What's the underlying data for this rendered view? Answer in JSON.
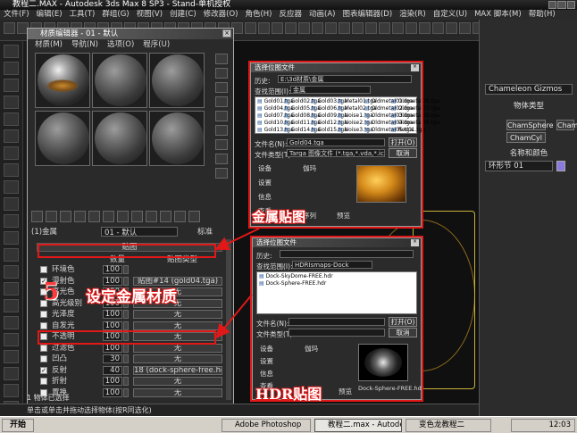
{
  "app": {
    "title": "教程二.MAX - Autodesk 3ds Max 8 SP3 - Stand-单机授权",
    "menu": [
      "文件(F)",
      "编辑(E)",
      "工具(T)",
      "群组(G)",
      "视图(V)",
      "创建(C)",
      "修改器(O)",
      "角色(H)",
      "反应器",
      "动画(A)",
      "图表编辑器(D)",
      "渲染(R)",
      "自定义(U)",
      "MAX 脚本(M)",
      "帮助(H)"
    ],
    "view_dropdown": "视图"
  },
  "command_panel": {
    "gizmo_dropdown": "Chameleon Gizmos",
    "object_type_header": "物体类型",
    "buttons": [
      "ChamSphere",
      "ChamBox",
      "ChamCyl"
    ],
    "name_color_header": "名称和颜色",
    "name_value": "环形节 01"
  },
  "material_editor": {
    "title": "材质编辑器 - 01 - 默认",
    "menu": [
      "材质(M)",
      "导航(N)",
      "选项(O)",
      "程序(U)"
    ],
    "material_name": "01 - 默认",
    "type_label": "标准",
    "shader_prefix": "(1)金属",
    "maps_header": "贴图",
    "col_amount": "数量",
    "col_map": "贴图类型",
    "maps": [
      {
        "checked": false,
        "label": "环境色",
        "amount": "100",
        "map": ""
      },
      {
        "checked": true,
        "label": "漫射色",
        "amount": "100",
        "map": "贴图#14 (gold04.tga)"
      },
      {
        "checked": false,
        "label": "高光色",
        "amount": "100",
        "map": "无"
      },
      {
        "checked": false,
        "label": "高光级别",
        "amount": "100",
        "map": "无"
      },
      {
        "checked": false,
        "label": "光泽度",
        "amount": "100",
        "map": "无"
      },
      {
        "checked": false,
        "label": "自发光",
        "amount": "100",
        "map": "无"
      },
      {
        "checked": false,
        "label": "不透明",
        "amount": "100",
        "map": "无"
      },
      {
        "checked": false,
        "label": "过滤色",
        "amount": "100",
        "map": "无"
      },
      {
        "checked": false,
        "label": "凹凸",
        "amount": "30",
        "map": "无"
      },
      {
        "checked": true,
        "label": "反射",
        "amount": "40",
        "map": "18 (dock-sphere-free.hdr"
      },
      {
        "checked": false,
        "label": "折射",
        "amount": "100",
        "map": "无"
      },
      {
        "checked": false,
        "label": "置换",
        "amount": "100",
        "map": "无"
      }
    ]
  },
  "dialog_top": {
    "title": "选择位图文件",
    "history_label": "历史:",
    "history_value": "E:\\3d材质\\金属",
    "lookin_label": "查找范围(I):",
    "lookin_value": "金属",
    "files": [
      "Gold01.tga",
      "Gold04.tga",
      "Gold07.tga",
      "Gold10.tga",
      "Gold13.tga",
      "Gold02.tga",
      "Gold05.tga",
      "Gold08.tga",
      "Gold11.tga",
      "Gold14.tga",
      "Gold03.tga",
      "Gold06.tga",
      "Gold09.tga",
      "Gold12.tga",
      "Gold15.tga",
      "Metal01.tga",
      "Metal02.tga",
      "Noise1.tga",
      "Noise2.tga",
      "Noise3.tga",
      "Oldmetal01.tga",
      "Oldmetal02.tga",
      "Oldmetal03.tga",
      "Oldmetal04.tga",
      "Oldmetal05.tga",
      "Oldmetal06.tga",
      "Oldmetal07.tga",
      "Oldmetal08.tga",
      "Oldmetal09.tga",
      "Red01.tga"
    ],
    "filename_label": "文件名(N):",
    "filename_value": "Gold04.tga",
    "filetype_label": "文件类型(T):",
    "filetype_value": "Targa 图像文件 (*.tga,*.vda,*.icb,*.vst)",
    "open_label": "打开(O)",
    "cancel_label": "取消",
    "device_label": "设备",
    "setup_label": "设置",
    "info_label": "信息",
    "view_label": "查看",
    "gamma_label": "伽玛",
    "sequence_label": "序列",
    "preview_label": "预览"
  },
  "dialog_bottom": {
    "title": "选择位图文件",
    "history_label": "历史:",
    "lookin_label": "查找范围(I):",
    "lookin_value": "HDRIsmaps-Dock",
    "files": [
      "Dock-SkyDome-FREE.hdr",
      "Dock-Sphere-FREE.hdr"
    ],
    "filename_label": "文件名(N):",
    "filename_value": "Dock-Sphere-FREE.hdr",
    "filetype_label": "文件类型(T):",
    "open_label": "打开(O)",
    "cancel_label": "取消",
    "device_label": "设备",
    "setup_label": "设置",
    "info_label": "信息",
    "view_label": "查看",
    "gamma_label": "伽玛",
    "sequence_label": "序列",
    "preview_label": "预览"
  },
  "annotations": {
    "step_number": "5",
    "step_text": "设定金属材质",
    "metal_map": "金属贴图",
    "hdr_map": "HDR贴图"
  },
  "status": {
    "text": "单击或单击并拖动选择物体(按R同选化)",
    "selected": "1 物体已选择"
  },
  "taskbar": {
    "start": "开始",
    "items": [
      "Adobe Photoshop",
      "教程二.max - Autodesk ...",
      "变色龙教程二"
    ],
    "time": "12:03"
  },
  "colors": {
    "annotation_red": "#e01818",
    "panel_bg": "#2c2c2c"
  }
}
